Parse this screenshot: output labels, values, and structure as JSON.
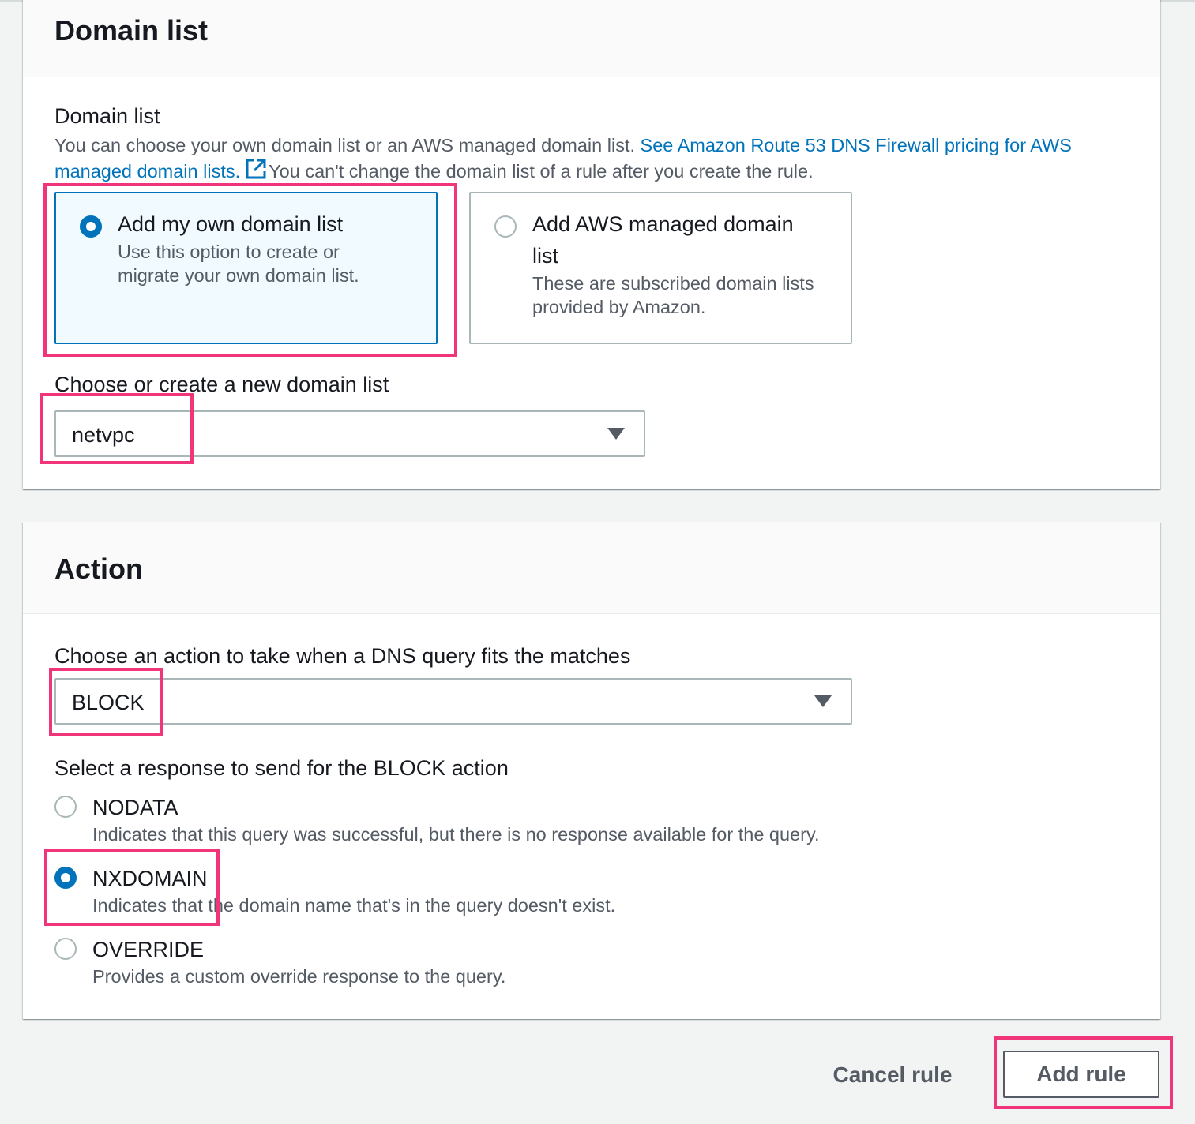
{
  "domain_list_section": {
    "title": "Domain list",
    "field_label": "Domain list",
    "description_text": "You can choose your own domain list or an AWS managed domain list. ",
    "pricing_link_text": "See Amazon Route 53 DNS Firewall pricing for AWS managed domain lists.",
    "description_suffix": "You can't change the domain list of a rule after you create the rule.",
    "tiles": [
      {
        "title": "Add my own domain list",
        "description": "Use this option to create or migrate your own domain list.",
        "selected": true
      },
      {
        "title": "Add AWS managed domain list",
        "description": "These are subscribed domain lists provided by Amazon.",
        "selected": false
      }
    ],
    "select_label": "Choose or create a new domain list",
    "select_value": "netvpc"
  },
  "action_section": {
    "title": "Action",
    "select_label": "Choose an action to take when a DNS query fits the matches",
    "select_value": "BLOCK",
    "response_label": "Select a response to send for the BLOCK action",
    "options": [
      {
        "label": "NODATA",
        "description": "Indicates that this query was successful, but there is no response available for the query.",
        "selected": false
      },
      {
        "label": "NXDOMAIN",
        "description": "Indicates that the domain name that's in the query doesn't exist.",
        "selected": true
      },
      {
        "label": "OVERRIDE",
        "description": "Provides a custom override response to the query.",
        "selected": false
      }
    ]
  },
  "footer": {
    "cancel_label": "Cancel rule",
    "submit_label": "Add rule"
  },
  "colors": {
    "accent": "#0073bb",
    "highlight": "#f0357a",
    "background": "#f2f3f3"
  }
}
